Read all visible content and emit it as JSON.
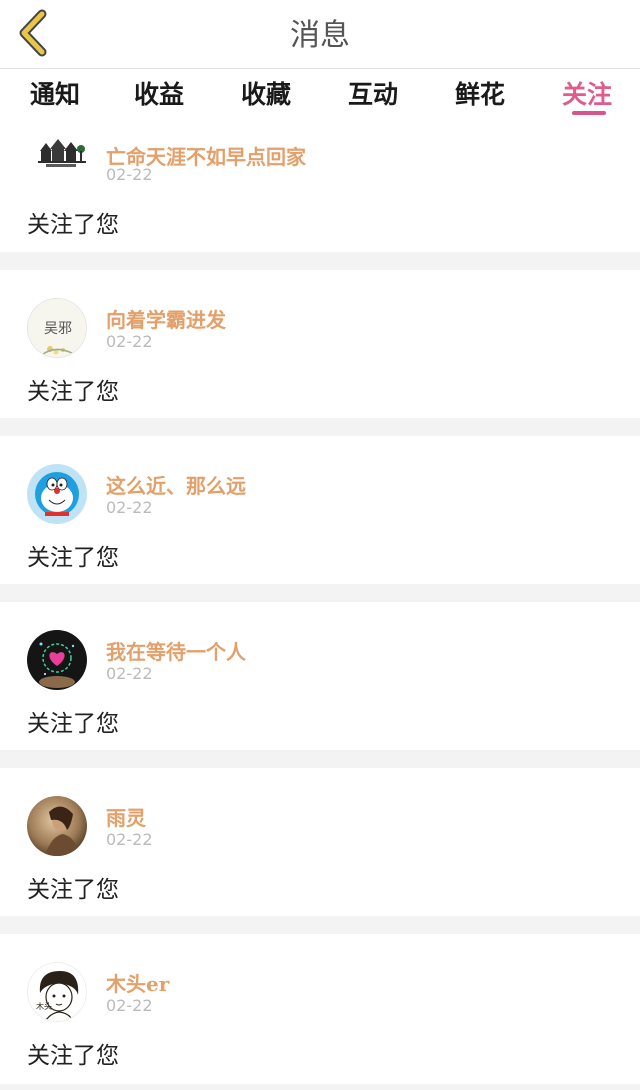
{
  "header": {
    "title": "消息"
  },
  "tabs": [
    {
      "label": "通知"
    },
    {
      "label": "收益"
    },
    {
      "label": "收藏"
    },
    {
      "label": "互动"
    },
    {
      "label": "鲜花"
    },
    {
      "label": "关注"
    }
  ],
  "active_tab": "关注",
  "colors": {
    "accent": "#e05c8f",
    "username": "#e3a06a",
    "back_icon": "#e8c64a"
  },
  "notifications": [
    {
      "user": "亡命天涯不如早点回家",
      "date": "02-22",
      "message": "关注了您",
      "avatar_icon": "houses-logo-icon"
    },
    {
      "user": "向着学霸进发",
      "date": "02-22",
      "message": "关注了您",
      "avatar_icon": "calligraphy-flower-avatar",
      "avatar_text": "吴邪"
    },
    {
      "user": "这么近、那么远",
      "date": "02-22",
      "message": "关注了您",
      "avatar_icon": "doraemon-avatar"
    },
    {
      "user": "我在等待一个人",
      "date": "02-22",
      "message": "关注了您",
      "avatar_icon": "dark-heart-avatar"
    },
    {
      "user": "雨灵",
      "date": "02-22",
      "message": "关注了您",
      "avatar_icon": "sepia-portrait-avatar"
    },
    {
      "user": "木头er",
      "date": "02-22",
      "message": "关注了您",
      "avatar_icon": "sketch-girl-avatar",
      "avatar_text": "木头"
    }
  ]
}
